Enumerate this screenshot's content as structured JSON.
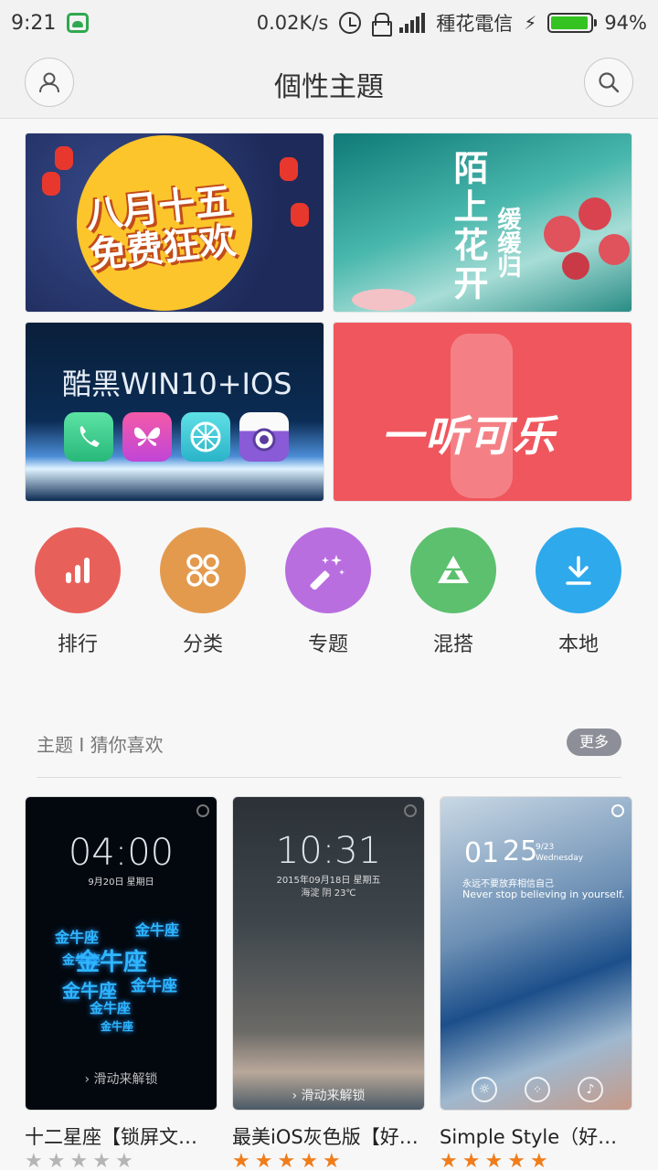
{
  "status_bar": {
    "time": "9:21",
    "net_speed": "0.02K/s",
    "carrier": "種花電信",
    "battery_percent": "94%",
    "battery_level": 0.94,
    "icons": [
      "cloud-icon",
      "alarm-icon",
      "lock-icon",
      "signal-icon",
      "charging-icon",
      "battery-icon"
    ]
  },
  "header": {
    "title": "個性主題",
    "left_icon": "user-icon",
    "right_icon": "search-icon"
  },
  "banners": [
    {
      "name": "mid-autumn",
      "text": "八月十五免费狂欢",
      "line1": "八月十五",
      "line2": "免费狂欢"
    },
    {
      "name": "flowers",
      "line1": "陌上花开",
      "line2": "缓缓归"
    },
    {
      "name": "win10-ios",
      "text": "酷黑WIN10+IOS"
    },
    {
      "name": "cola",
      "text": "一听可乐"
    }
  ],
  "categories": [
    {
      "label": "排行",
      "icon": "ranking-icon",
      "color": "#e8605a"
    },
    {
      "label": "分类",
      "icon": "category-icon",
      "color": "#e39a4d"
    },
    {
      "label": "专题",
      "icon": "magic-wand-icon",
      "color": "#b96ee0"
    },
    {
      "label": "混搭",
      "icon": "mix-icon",
      "color": "#5cc06e"
    },
    {
      "label": "本地",
      "icon": "download-icon",
      "color": "#2ea9ec"
    }
  ],
  "section": {
    "title": "主题 I 猜你喜欢",
    "more": "更多"
  },
  "themes": [
    {
      "name": "十二星座【锁屏文…",
      "rating": 0,
      "clock": "04:00",
      "date": "9月20日 星期日",
      "heart_word": "金牛座",
      "slide_hint": "滑动来解锁"
    },
    {
      "name": "最美iOS灰色版【好…",
      "rating": 5,
      "clock": "10:31",
      "date": "2015年09月18日 星期五",
      "weather": "海淀 阴 23℃",
      "slide_hint": "滑动来解锁"
    },
    {
      "name": "Simple Style（好评…",
      "rating": 5,
      "clock_hour": "01",
      "clock_min": "25",
      "date_small": "9/23",
      "weekday": "Wednesday",
      "quote_cn": "永远不要放弃相信自己",
      "quote_en": "Never stop believing in yourself."
    }
  ],
  "colors": {
    "star_filled": "#f07d1b",
    "star_empty": "#b5b5b5",
    "more_button": "#8c8f98"
  }
}
